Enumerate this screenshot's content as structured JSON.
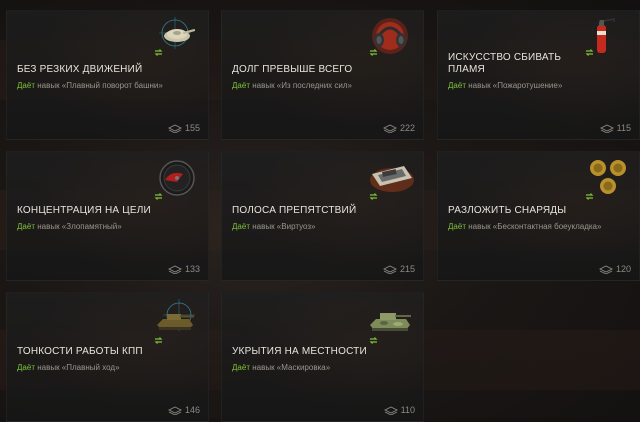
{
  "colors": {
    "accent_green": "#7ec23a",
    "title_text": "#e8e4dc",
    "desc_text": "#9a968e",
    "count_text": "#8e8a84"
  },
  "verb": "Даёт",
  "cards": [
    {
      "title": "Без резких движений",
      "skill_text": "навык «Плавный поворот башни»",
      "count": "155",
      "icon": "turret-rotation-icon"
    },
    {
      "title": "Долг превыше всего",
      "skill_text": "навык «Из последних сил»",
      "count": "222",
      "icon": "headphones-icon"
    },
    {
      "title": "Искусство сбивать пламя",
      "skill_text": "навык «Пожаротушение»",
      "count": "115",
      "icon": "fire-extinguisher-icon"
    },
    {
      "title": "Концентрация на цели",
      "skill_text": "навык «Злопамятный»",
      "count": "133",
      "icon": "target-gauge-icon"
    },
    {
      "title": "Полоса препятствий",
      "skill_text": "навык «Виртуоз»",
      "count": "215",
      "icon": "tank-manual-icon"
    },
    {
      "title": "Разложить снаряды",
      "skill_text": "навык «Бесконтактная боеукладка»",
      "count": "120",
      "icon": "shells-icon"
    },
    {
      "title": "Тонкости работы КПП",
      "skill_text": "навык «Плавный ход»",
      "count": "146",
      "icon": "tank-crosshair-icon"
    },
    {
      "title": "Укрытия на местности",
      "skill_text": "навык «Маскировка»",
      "count": "110",
      "icon": "camo-tank-icon"
    }
  ]
}
